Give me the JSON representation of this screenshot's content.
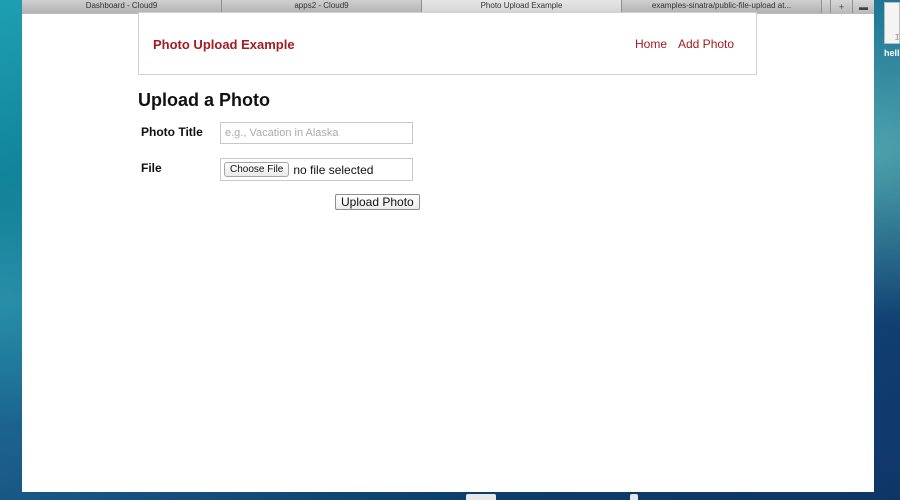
{
  "browser": {
    "tabs": [
      {
        "title": "Dashboard - Cloud9"
      },
      {
        "title": "apps2 - Cloud9"
      },
      {
        "title": "Photo Upload Example"
      },
      {
        "title": "examples-sinatra/public-file-upload at..."
      }
    ],
    "active_tab": 2,
    "tools": {
      "add_icon": "plus-icon",
      "menu_icon": "menu-icon",
      "add_glyph": "+",
      "menu_glyph": "▬"
    }
  },
  "navbar": {
    "brand": "Photo Upload Example",
    "links": [
      "Home",
      "Add Photo"
    ],
    "link_color": "#a21c22"
  },
  "form": {
    "heading": "Upload a Photo",
    "title_label": "Photo Title",
    "title_placeholder": "e.g., Vacation in Alaska",
    "title_value": "",
    "file_label": "File",
    "choose_button": "Choose File",
    "file_status": "no file selected",
    "submit_label": "Upload Photo"
  },
  "desktop": {
    "file_label": "hell",
    "file_icon_text": "T̲"
  }
}
